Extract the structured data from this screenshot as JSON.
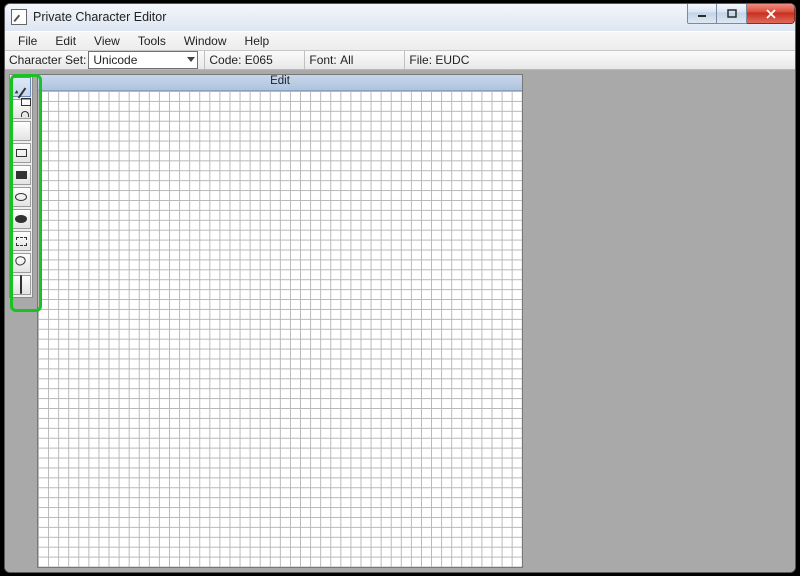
{
  "window": {
    "title": "Private Character Editor"
  },
  "menu": {
    "file": "File",
    "edit": "Edit",
    "view": "View",
    "tools": "Tools",
    "window": "Window",
    "help": "Help"
  },
  "infobar": {
    "charset_label": "Character Set:",
    "charset_value": "Unicode",
    "code_label": "Code:",
    "code_value": "E065",
    "font_label": "Font:",
    "font_value": "All",
    "file_label": "File:",
    "file_value": "EUDC"
  },
  "edit_panel": {
    "caption": "Edit"
  },
  "tools": {
    "pencil": "pencil",
    "brush": "brush",
    "line": "line",
    "rect": "rectangle",
    "rect_filled": "filled-rectangle",
    "ellipse": "ellipse",
    "ellipse_filled": "filled-ellipse",
    "select_rect": "rectangular-selection",
    "select_free": "freeform-selection",
    "eraser": "eraser"
  }
}
